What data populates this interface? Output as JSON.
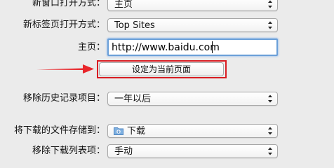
{
  "prefs": {
    "new_window": {
      "label": "新窗口打开方式：",
      "value": "主页"
    },
    "new_tab": {
      "label": "新标签页打开方式：",
      "value": "Top Sites"
    },
    "homepage": {
      "label": "主页：",
      "value": "http://www.baidu.com"
    },
    "set_current_button": "设定为当前页面",
    "remove_history": {
      "label": "移除历史记录项目：",
      "value": "一年以后"
    },
    "save_downloads": {
      "label": "将下载的文件存储到：",
      "value": "下载",
      "icon": "downloads-folder-icon"
    },
    "remove_downloads": {
      "label": "移除下载列表项：",
      "value": "手动"
    }
  },
  "annotation": {
    "arrow_color": "#e8262b",
    "box_color": "#d91c22"
  }
}
